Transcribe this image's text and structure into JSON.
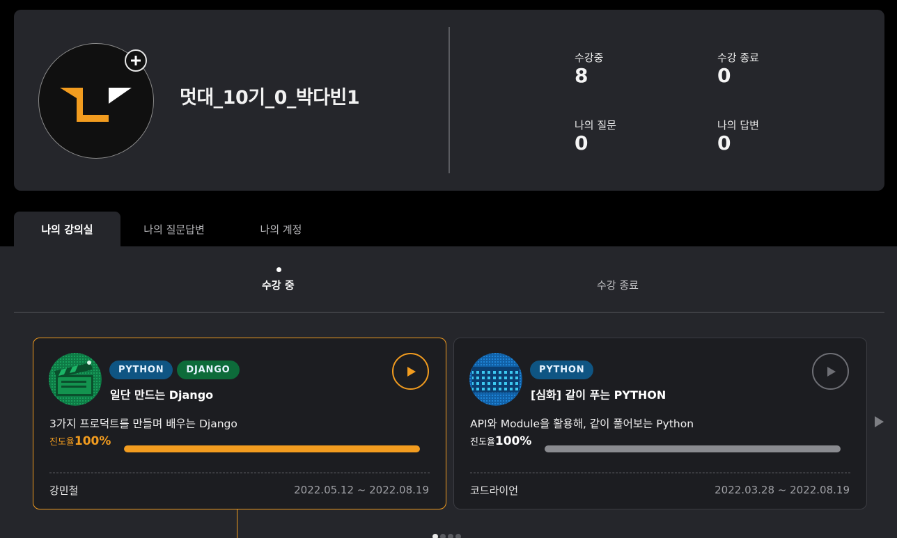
{
  "profile": {
    "user_name": "멋대_10기_0_박다빈1",
    "avatar_icon": "bracket-logo-icon",
    "avatar_add_icon": "plus-icon",
    "stats": [
      {
        "label": "수강중",
        "value": "8"
      },
      {
        "label": "수강 종료",
        "value": "0"
      },
      {
        "label": "나의 질문",
        "value": "0"
      },
      {
        "label": "나의 답변",
        "value": "0"
      }
    ]
  },
  "tabs": [
    {
      "label": "나의 강의실",
      "active": true
    },
    {
      "label": "나의 질문답변",
      "active": false
    },
    {
      "label": "나의 계정",
      "active": false
    }
  ],
  "subtabs": [
    {
      "label": "수강 중",
      "active": true
    },
    {
      "label": "수강 종료",
      "active": false
    }
  ],
  "courses": [
    {
      "tags": [
        {
          "label": "PYTHON",
          "color": "#0f5583"
        },
        {
          "label": "DJANGO",
          "color": "#0d6b3a"
        }
      ],
      "title": "일단 만드는 Django",
      "description": "3가지 프로덕트를 만들며 배우는 Django",
      "progress_label": "진도율",
      "progress_value": "100%",
      "progress": 1.0,
      "instructor": "강민철",
      "period": "2022.05.12 ~ 2022.08.19",
      "selected": true,
      "accent": "#f29c1f",
      "thumb_icon": "clapperboard-icon"
    },
    {
      "tags": [
        {
          "label": "PYTHON",
          "color": "#0f5583"
        }
      ],
      "title": "[심화] 같이 푸는 PYTHON",
      "description": "API와 Module을 활용해, 같이 풀어보는 Python",
      "progress_label": "진도율",
      "progress_value": "100%",
      "progress": 1.0,
      "instructor": "코드라이언",
      "period": "2022.03.28 ~ 2022.08.19",
      "selected": false,
      "accent": "#8a8b90",
      "thumb_icon": "pixel-pattern-icon"
    }
  ],
  "pager": {
    "count": 4,
    "current": 0
  },
  "colors": {
    "accent": "#f29c1f",
    "panel": "#25262b",
    "card": "#1c1d21"
  }
}
